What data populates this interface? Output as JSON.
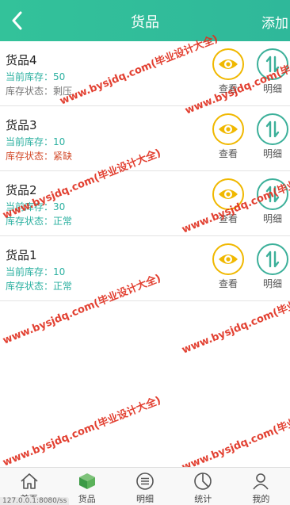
{
  "header": {
    "title": "货品",
    "add_label": "添加"
  },
  "goods": [
    {
      "name": "货品4",
      "stock_label": "当前库存：50",
      "status_label": "库存状态：剩压",
      "status_type": "surplus"
    },
    {
      "name": "货品3",
      "stock_label": "当前库存：10",
      "status_label": "库存状态：紧缺",
      "status_type": "tight"
    },
    {
      "name": "货品2",
      "stock_label": "当前库存：30",
      "status_label": "库存状态：正常",
      "status_type": "normal"
    },
    {
      "name": "货品1",
      "stock_label": "当前库存：10",
      "status_label": "库存状态：正常",
      "status_type": "normal"
    }
  ],
  "actions": {
    "view_label": "查看",
    "detail_label": "明细"
  },
  "tabbar": {
    "items": [
      {
        "label": "首页",
        "icon": "home-icon"
      },
      {
        "label": "货品",
        "icon": "cube-icon"
      },
      {
        "label": "明细",
        "icon": "list-icon"
      },
      {
        "label": "统计",
        "icon": "pie-chart-icon"
      },
      {
        "label": "我的",
        "icon": "user-icon"
      }
    ]
  },
  "statusbar": {
    "url": "127.0.0.1:8080/ss"
  },
  "watermark": "www.bysjdq.com(毕业设计大全)",
  "colors": {
    "header": "#33c29a",
    "view_ring": "#f0b800",
    "detail_ring": "#3cb09a",
    "normal_status": "#2bb0a0",
    "tight_status": "#d24a2a",
    "watermark": "#e03020"
  }
}
